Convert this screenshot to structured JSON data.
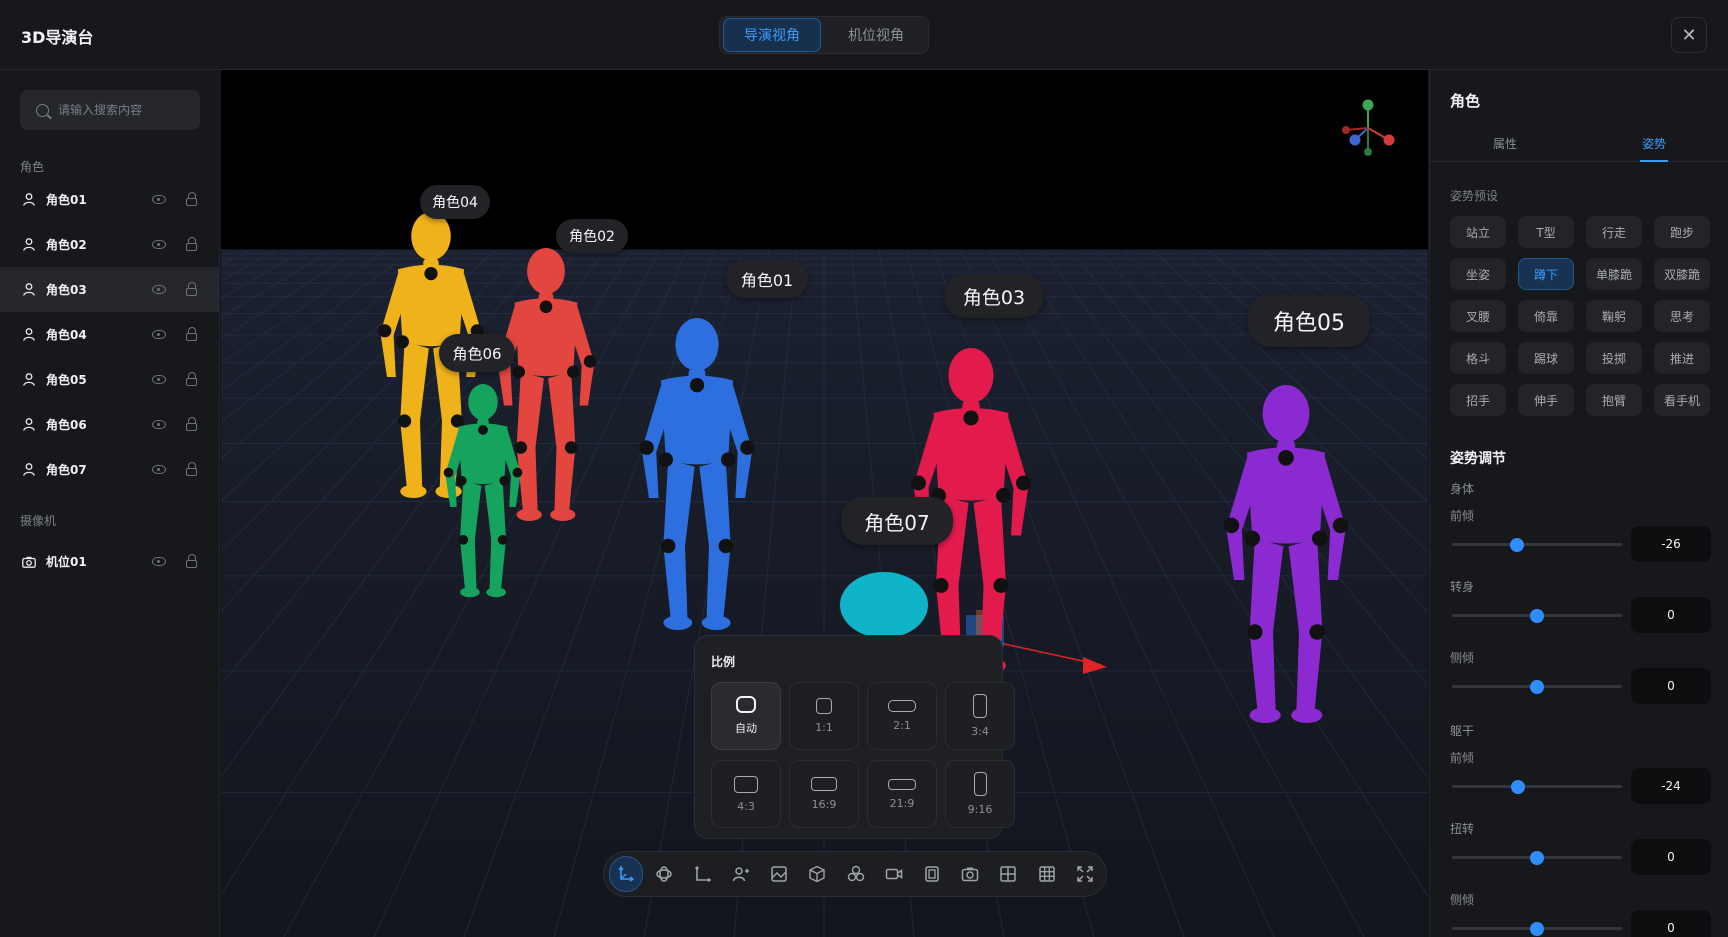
{
  "app": {
    "title": "3D导演台"
  },
  "view_switch": {
    "active": "导演视角",
    "idle": "机位视角"
  },
  "window": {
    "close_glyph": "✕"
  },
  "sidebar": {
    "search_placeholder": "请输入搜索内容",
    "roles_label": "角色",
    "roles": [
      {
        "label": "角色01",
        "selected": false
      },
      {
        "label": "角色02",
        "selected": false
      },
      {
        "label": "角色03",
        "selected": true
      },
      {
        "label": "角色04",
        "selected": false
      },
      {
        "label": "角色05",
        "selected": false
      },
      {
        "label": "角色06",
        "selected": false
      },
      {
        "label": "角色07",
        "selected": false
      }
    ],
    "cameras_label": "摄像机",
    "cameras": [
      {
        "label": "机位01"
      }
    ]
  },
  "viewport": {
    "labels": [
      "角色04",
      "角色02",
      "角色01",
      "角色03",
      "角色05",
      "角色06",
      "角色07"
    ],
    "figure_colors": {
      "r04": "#f0b21a",
      "r02": "#e2463f",
      "r01": "#2e6fe0",
      "r03": "#e31b4c",
      "r05": "#8a2ad0",
      "r06": "#16a35e",
      "r07": "#0fb4c8"
    },
    "axis_gizmo": {
      "y": "Y",
      "x": "X",
      "z": "Z"
    }
  },
  "ratio_panel": {
    "title": "比例",
    "options": [
      "自动",
      "1:1",
      "2:1",
      "3:4",
      "4:3",
      "16:9",
      "21:9",
      "9:16"
    ],
    "selected": "自动"
  },
  "toolbar": {
    "tools": [
      "axis-move-icon",
      "rotate-icon",
      "bend-axis-icon",
      "add-person-icon",
      "image-icon",
      "cube-icon",
      "group-icon",
      "video-camera-icon",
      "frame-icon",
      "camera-icon",
      "grid-2-icon",
      "grid-3-icon",
      "fullscreen-icon"
    ],
    "active": "axis-move-icon"
  },
  "right_panel": {
    "title": "角色",
    "tabs": [
      "属性",
      "姿势"
    ],
    "active_tab": "姿势",
    "presets_label": "姿势预设",
    "presets": [
      "站立",
      "T型",
      "行走",
      "跑步",
      "坐姿",
      "蹲下",
      "单膝跪",
      "双膝跪",
      "叉腰",
      "倚靠",
      "鞠躬",
      "思考",
      "格斗",
      "踢球",
      "投掷",
      "推进",
      "招手",
      "伸手",
      "抱臂",
      "看手机"
    ],
    "active_preset": "蹲下",
    "adjust_title": "姿势调节",
    "groups": [
      {
        "name": "身体",
        "sliders": [
          {
            "label": "前倾",
            "value": "-26",
            "level": 0.38
          },
          {
            "label": "转身",
            "value": "0",
            "level": 0.5
          },
          {
            "label": "侧倾",
            "value": "0",
            "level": 0.5
          }
        ]
      },
      {
        "name": "躯干",
        "sliders": [
          {
            "label": "前倾",
            "value": "-24",
            "level": 0.39
          },
          {
            "label": "扭转",
            "value": "0",
            "level": 0.5
          },
          {
            "label": "侧倾",
            "value": "0",
            "level": 0.5
          }
        ]
      }
    ]
  }
}
